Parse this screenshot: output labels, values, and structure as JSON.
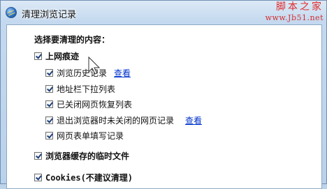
{
  "window": {
    "title": "清理浏览记录",
    "watermark_cn": "脚本之家",
    "watermark_url": "www.Jb51.net"
  },
  "dialog": {
    "section_title": "选择要清理的内容：",
    "groups": [
      {
        "label": "上网痕迹",
        "checked": true,
        "children": [
          {
            "label": "浏览历史记录",
            "checked": true,
            "link": "查看"
          },
          {
            "label": "地址栏下拉列表",
            "checked": true
          },
          {
            "label": "已关闭网页恢复列表",
            "checked": true
          },
          {
            "label": "退出浏览器时未关闭的网页记录",
            "checked": true,
            "link": "查看"
          },
          {
            "label": "网页表单填写记录",
            "checked": true
          }
        ]
      },
      {
        "label": "浏览器缓存的临时文件",
        "checked": true
      },
      {
        "label": "Cookies(不建议清理)",
        "checked": true
      }
    ]
  },
  "colors": {
    "accent": "#0033cc",
    "watermark": "#e02b2b",
    "frame": "#b9d1ea"
  }
}
